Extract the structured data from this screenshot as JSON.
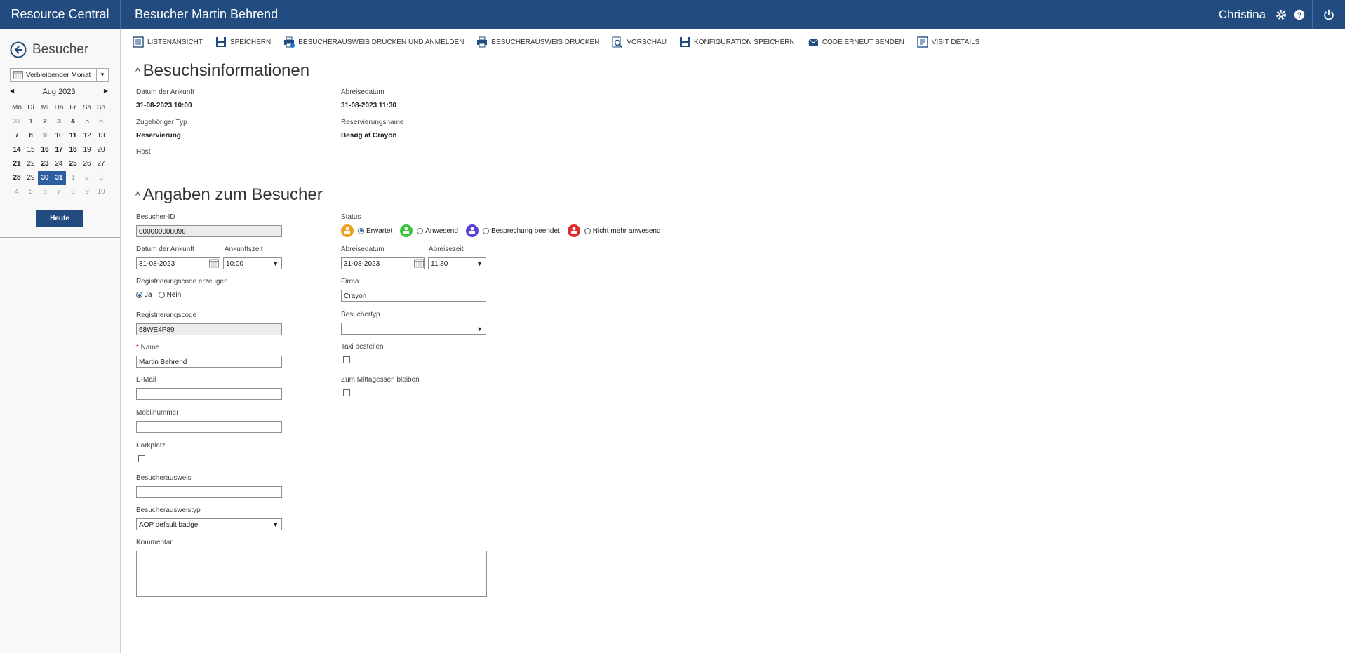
{
  "app": {
    "title": "Resource Central",
    "page_title": "Besucher Martin Behrend",
    "user": "Christina"
  },
  "sidebar": {
    "heading": "Besucher",
    "range_select": "Verbleibender Monat",
    "calendar": {
      "month": "Aug 2023",
      "weekdays": [
        "Mo",
        "Di",
        "Mi",
        "Do",
        "Fr",
        "Sa",
        "So"
      ],
      "days": [
        {
          "d": "31",
          "c": "other"
        },
        {
          "d": "1",
          "c": ""
        },
        {
          "d": "2",
          "c": "bold"
        },
        {
          "d": "3",
          "c": "bold"
        },
        {
          "d": "4",
          "c": "bold"
        },
        {
          "d": "5",
          "c": ""
        },
        {
          "d": "6",
          "c": ""
        },
        {
          "d": "7",
          "c": "bold"
        },
        {
          "d": "8",
          "c": "bold"
        },
        {
          "d": "9",
          "c": "bold"
        },
        {
          "d": "10",
          "c": ""
        },
        {
          "d": "11",
          "c": "bold"
        },
        {
          "d": "12",
          "c": ""
        },
        {
          "d": "13",
          "c": ""
        },
        {
          "d": "14",
          "c": "bold"
        },
        {
          "d": "15",
          "c": ""
        },
        {
          "d": "16",
          "c": "bold"
        },
        {
          "d": "17",
          "c": "bold"
        },
        {
          "d": "18",
          "c": "bold"
        },
        {
          "d": "19",
          "c": ""
        },
        {
          "d": "20",
          "c": ""
        },
        {
          "d": "21",
          "c": "bold"
        },
        {
          "d": "22",
          "c": ""
        },
        {
          "d": "23",
          "c": "bold"
        },
        {
          "d": "24",
          "c": ""
        },
        {
          "d": "25",
          "c": "bold"
        },
        {
          "d": "26",
          "c": ""
        },
        {
          "d": "27",
          "c": ""
        },
        {
          "d": "28",
          "c": "bold"
        },
        {
          "d": "29",
          "c": ""
        },
        {
          "d": "30",
          "c": "sel"
        },
        {
          "d": "31",
          "c": "sel"
        },
        {
          "d": "1",
          "c": "other"
        },
        {
          "d": "2",
          "c": "other"
        },
        {
          "d": "3",
          "c": "other"
        },
        {
          "d": "4",
          "c": "other"
        },
        {
          "d": "5",
          "c": "other"
        },
        {
          "d": "6",
          "c": "other"
        },
        {
          "d": "7",
          "c": "other"
        },
        {
          "d": "8",
          "c": "other"
        },
        {
          "d": "9",
          "c": "other"
        },
        {
          "d": "10",
          "c": "other"
        }
      ]
    },
    "today_button": "Heute"
  },
  "toolbar": {
    "list_view": "LISTENANSICHT",
    "save": "SPEICHERN",
    "print_badge_register": "BESUCHERAUSWEIS DRUCKEN UND ANMELDEN",
    "print_badge": "BESUCHERAUSWEIS DRUCKEN",
    "preview": "VORSCHAU",
    "save_config": "KONFIGURATION SPEICHERN",
    "resend_code": "CODE ERNEUT SENDEN",
    "visit_details": "VISIT DETAILS"
  },
  "visit_info": {
    "title": "Besuchsinformationen",
    "arrival_label": "Datum der Ankunft",
    "arrival_value": "31-08-2023 10:00",
    "departure_label": "Abreisedatum",
    "departure_value": "31-08-2023 11:30",
    "type_label": "Zugehöriger Typ",
    "type_value": "Reservierung",
    "resname_label": "Reservierungsname",
    "resname_value": "Besøg af Crayon",
    "host_label": "Host"
  },
  "visitor": {
    "title": "Angaben zum Besucher",
    "id_label": "Besucher-ID",
    "id_value": "000000008098",
    "arrival_date_label": "Datum der Ankunft",
    "arrival_date_value": "31-08-2023",
    "arrival_time_label": "Ankunftszeit",
    "arrival_time_value": "10:00",
    "regcode_gen_label": "Registrierungscode erzeugen",
    "yes": "Ja",
    "no": "Nein",
    "regcode_label": "Registrierungscode",
    "regcode_value": "68WE4P89",
    "name_label": "Name",
    "name_value": "Martin Behrend",
    "email_label": "E-Mail",
    "email_value": "",
    "mobile_label": "Mobilnummer",
    "mobile_value": "",
    "parking_label": "Parkplatz",
    "badge_label": "Besucherausweis",
    "badge_value": "",
    "badge_type_label": "Besucherausweistyp",
    "badge_type_value": "AOP default badge",
    "comment_label": "Kommentar",
    "status_label": "Status",
    "status_expected": "Erwartet",
    "status_present": "Anwesend",
    "status_meeting_ended": "Besprechung beendet",
    "status_gone": "Nicht mehr anwesend",
    "departure_date_label": "Abreisedatum",
    "departure_date_value": "31-08-2023",
    "departure_time_label": "Abreisezeit",
    "departure_time_value": "11:30",
    "company_label": "Firma",
    "company_value": "Crayon",
    "visitor_type_label": "Besuchertyp",
    "visitor_type_value": "",
    "taxi_label": "Taxi bestellen",
    "lunch_label": "Zum Mittagessen bleiben"
  },
  "colors": {
    "brand": "#224c80",
    "expected": "#f0a020",
    "present": "#3cc43c",
    "meeting_ended": "#5b3fd8",
    "gone": "#e02a2a"
  }
}
